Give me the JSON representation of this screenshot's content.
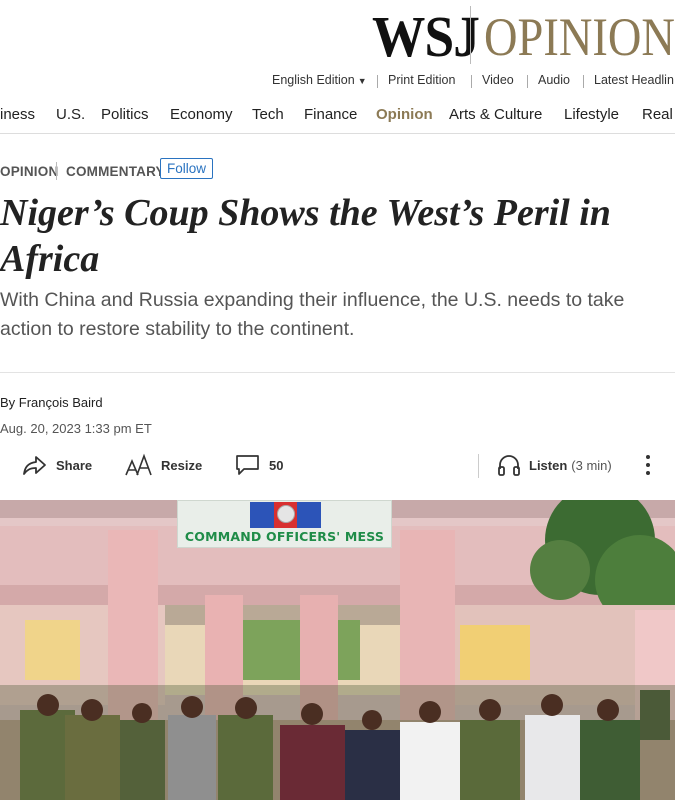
{
  "masthead": {
    "brand": "WSJ",
    "section": "OPINION",
    "brand_color": "#111111",
    "section_color": "#8c7a55"
  },
  "utility_links": [
    {
      "label": "English Edition",
      "has_caret": true
    },
    {
      "label": "Print Edition"
    },
    {
      "label": "Video"
    },
    {
      "label": "Audio"
    },
    {
      "label": "Latest Headlin"
    }
  ],
  "nav": {
    "items": [
      {
        "label": "iness"
      },
      {
        "label": "U.S."
      },
      {
        "label": "Politics"
      },
      {
        "label": "Economy"
      },
      {
        "label": "Tech"
      },
      {
        "label": "Finance"
      },
      {
        "label": "Opinion",
        "active": true
      },
      {
        "label": "Arts & Culture"
      },
      {
        "label": "Lifestyle"
      },
      {
        "label": "Real"
      }
    ],
    "active_color": "#8c7a55"
  },
  "article": {
    "section_label": "OPINION",
    "category_label": "COMMENTARY",
    "follow_label": "Follow",
    "headline": "Niger’s Coup Shows the West’s Peril in Africa",
    "dek": "With China and Russia expanding their influence, the U.S. needs to take action to restore stability to the continent.",
    "byline": "By François Baird",
    "timestamp": "Aug. 20, 2023 1:33 pm ET"
  },
  "toolbar": {
    "share_label": "Share",
    "resize_label": "Resize",
    "comments_count": "50",
    "listen_label": "Listen",
    "listen_duration": "(3 min)"
  },
  "photo": {
    "sign_text": "COMMAND OFFICERS' MESS",
    "sign_text_color": "#1f8c48",
    "flag_colors": [
      "#2c54b8",
      "#d83030",
      "#2c54b8"
    ]
  }
}
